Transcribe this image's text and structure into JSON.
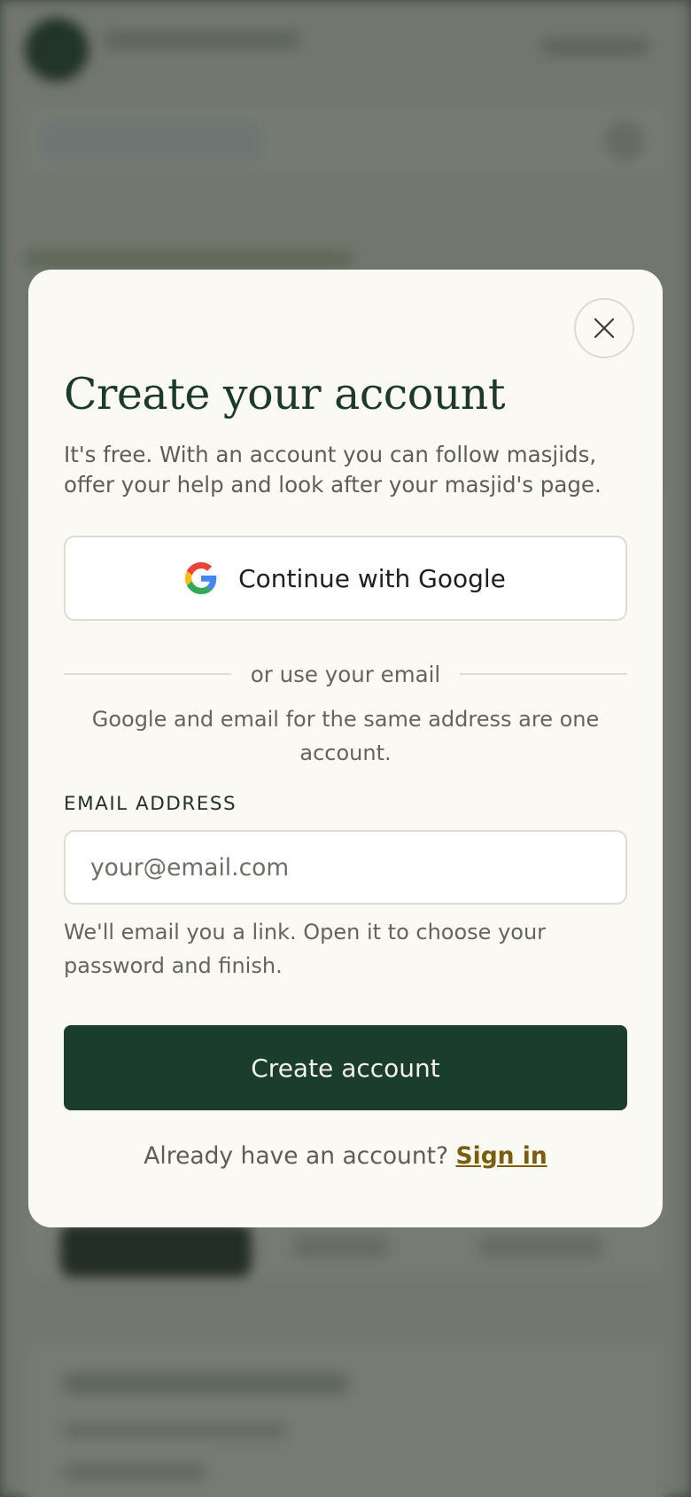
{
  "modal": {
    "title": "Create your account",
    "subtitle": "It's free. With an account you can follow masjids, offer your help and look after your masjid's page.",
    "google_button_label": "Continue with Google",
    "divider_text": "or use your email",
    "note": "Google and email for the same address are one account.",
    "email_label": "EMAIL ADDRESS",
    "email_value": "",
    "email_placeholder": "your@email.com",
    "helper_text": "We'll email you a link. Open it to choose your password and finish.",
    "submit_label": "Create account",
    "signin_prompt": "Already have an account?",
    "signin_link": "Sign in"
  },
  "icons": {
    "close": "close-icon",
    "google": "google-icon"
  },
  "colors": {
    "primary": "#1b3d2d",
    "title": "#1b3a2c",
    "link": "#7a5e0d",
    "modal_bg": "#fbf9f3"
  }
}
